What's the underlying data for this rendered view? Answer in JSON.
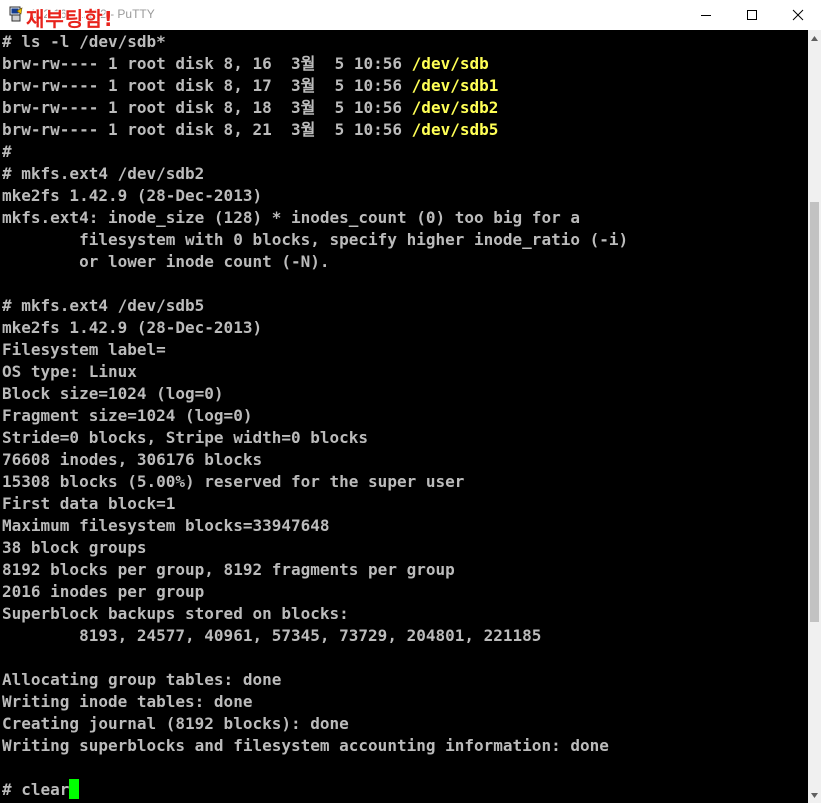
{
  "window": {
    "title": "192.168.1.132 - PuTTY",
    "overlay_text": "재부팅함!",
    "app_icon": "putty-icon",
    "controls": [
      "minimize-icon",
      "maximize-icon",
      "close-icon"
    ]
  },
  "terminal": {
    "lines": [
      {
        "pre": "# ls -l /dev/sdb*",
        "path": ""
      },
      {
        "pre": "brw-rw---- 1 root disk 8, 16  3월  5 10:56 ",
        "path": "/dev/sdb"
      },
      {
        "pre": "brw-rw---- 1 root disk 8, 17  3월  5 10:56 ",
        "path": "/dev/sdb1"
      },
      {
        "pre": "brw-rw---- 1 root disk 8, 18  3월  5 10:56 ",
        "path": "/dev/sdb2"
      },
      {
        "pre": "brw-rw---- 1 root disk 8, 21  3월  5 10:56 ",
        "path": "/dev/sdb5"
      },
      {
        "pre": "#",
        "path": ""
      },
      {
        "pre": "# mkfs.ext4 /dev/sdb2",
        "path": ""
      },
      {
        "pre": "mke2fs 1.42.9 (28-Dec-2013)",
        "path": ""
      },
      {
        "pre": "mkfs.ext4: inode_size (128) * inodes_count (0) too big for a",
        "path": ""
      },
      {
        "pre": "        filesystem with 0 blocks, specify higher inode_ratio (-i)",
        "path": ""
      },
      {
        "pre": "        or lower inode count (-N).",
        "path": ""
      },
      {
        "pre": "",
        "path": ""
      },
      {
        "pre": "# mkfs.ext4 /dev/sdb5",
        "path": ""
      },
      {
        "pre": "mke2fs 1.42.9 (28-Dec-2013)",
        "path": ""
      },
      {
        "pre": "Filesystem label=",
        "path": ""
      },
      {
        "pre": "OS type: Linux",
        "path": ""
      },
      {
        "pre": "Block size=1024 (log=0)",
        "path": ""
      },
      {
        "pre": "Fragment size=1024 (log=0)",
        "path": ""
      },
      {
        "pre": "Stride=0 blocks, Stripe width=0 blocks",
        "path": ""
      },
      {
        "pre": "76608 inodes, 306176 blocks",
        "path": ""
      },
      {
        "pre": "15308 blocks (5.00%) reserved for the super user",
        "path": ""
      },
      {
        "pre": "First data block=1",
        "path": ""
      },
      {
        "pre": "Maximum filesystem blocks=33947648",
        "path": ""
      },
      {
        "pre": "38 block groups",
        "path": ""
      },
      {
        "pre": "8192 blocks per group, 8192 fragments per group",
        "path": ""
      },
      {
        "pre": "2016 inodes per group",
        "path": ""
      },
      {
        "pre": "Superblock backups stored on blocks:",
        "path": ""
      },
      {
        "pre": "        8193, 24577, 40961, 57345, 73729, 204801, 221185",
        "path": ""
      },
      {
        "pre": "",
        "path": ""
      },
      {
        "pre": "Allocating group tables: done",
        "path": ""
      },
      {
        "pre": "Writing inode tables: done",
        "path": ""
      },
      {
        "pre": "Creating journal (8192 blocks): done",
        "path": ""
      },
      {
        "pre": "Writing superblocks and filesystem accounting information: done",
        "path": ""
      },
      {
        "pre": "",
        "path": ""
      },
      {
        "pre": "# clear",
        "path": ""
      }
    ],
    "prompt_line_index": 34
  },
  "colors": {
    "background": "#000000",
    "text": "#bbbbbb",
    "device_path": "#ffff55",
    "cursor": "#00ff00",
    "overlay": "#e8231c"
  }
}
